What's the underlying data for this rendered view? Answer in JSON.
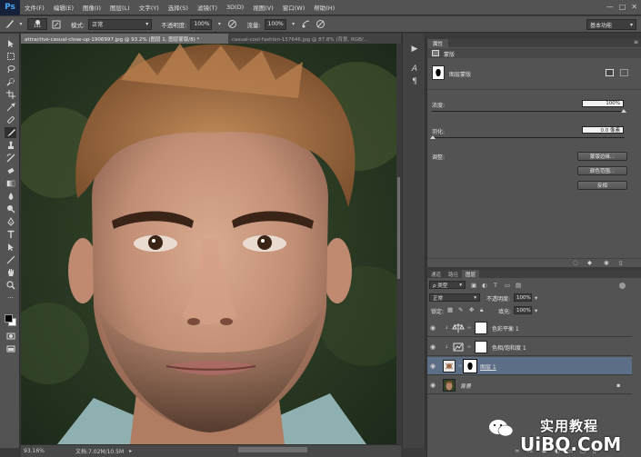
{
  "app": {
    "logo": "Ps"
  },
  "menu": [
    "文件(F)",
    "编辑(E)",
    "图像(I)",
    "图层(L)",
    "文字(Y)",
    "选择(S)",
    "滤镜(T)",
    "3D(D)",
    "视图(V)",
    "窗口(W)",
    "帮助(H)"
  ],
  "window_controls": {
    "minimize": "—",
    "maximize": "□",
    "close": "✕"
  },
  "options": {
    "brush_size": "141",
    "mode_label": "模式:",
    "mode_value": "正常",
    "opacity_label": "不透明度:",
    "opacity_value": "100%",
    "flow_label": "流量:",
    "flow_value": "100%",
    "workspace": "基本功能"
  },
  "doc_tabs": [
    {
      "label": "attractive-casual-close-up-1906997.jpg @ 93.2% (图层 1, 图层蒙版/8) *",
      "active": true
    },
    {
      "label": "casual-cool-fashion-157646.jpg @ 87.8% (背景, RGB/...",
      "active": false
    }
  ],
  "status": {
    "zoom": "93.16%",
    "doc": "文档:7.02M/10.5M"
  },
  "properties": {
    "tab": "属性",
    "mask_header": "蒙版",
    "layer_mask_label": "图层蒙版",
    "density_label": "浓度:",
    "density_value": "100%",
    "feather_label": "羽化:",
    "feather_value": "0.0 像素",
    "adjust_label": "调整:",
    "buttons": [
      "蒙版边缘...",
      "颜色范围...",
      "反相"
    ]
  },
  "layers": {
    "tabs": [
      {
        "label": "通道",
        "active": false
      },
      {
        "label": "路径",
        "active": false
      },
      {
        "label": "图层",
        "active": true
      }
    ],
    "filter_kind": "ρ 类型",
    "blend_mode": "正常",
    "opacity_label": "不透明度:",
    "opacity_value": "100%",
    "lock_label": "锁定:",
    "fill_label": "填充:",
    "fill_value": "100%",
    "items": [
      {
        "name": "色彩平衡 1",
        "type": "adjustment",
        "selected": false
      },
      {
        "name": "色相/饱和度 1",
        "type": "adjustment",
        "selected": false
      },
      {
        "name": "图层 1",
        "type": "masked",
        "selected": true
      },
      {
        "name": "背景",
        "type": "background",
        "selected": false
      }
    ]
  },
  "watermark": {
    "text": "实用教程",
    "url": "UiBQ.CoM"
  }
}
